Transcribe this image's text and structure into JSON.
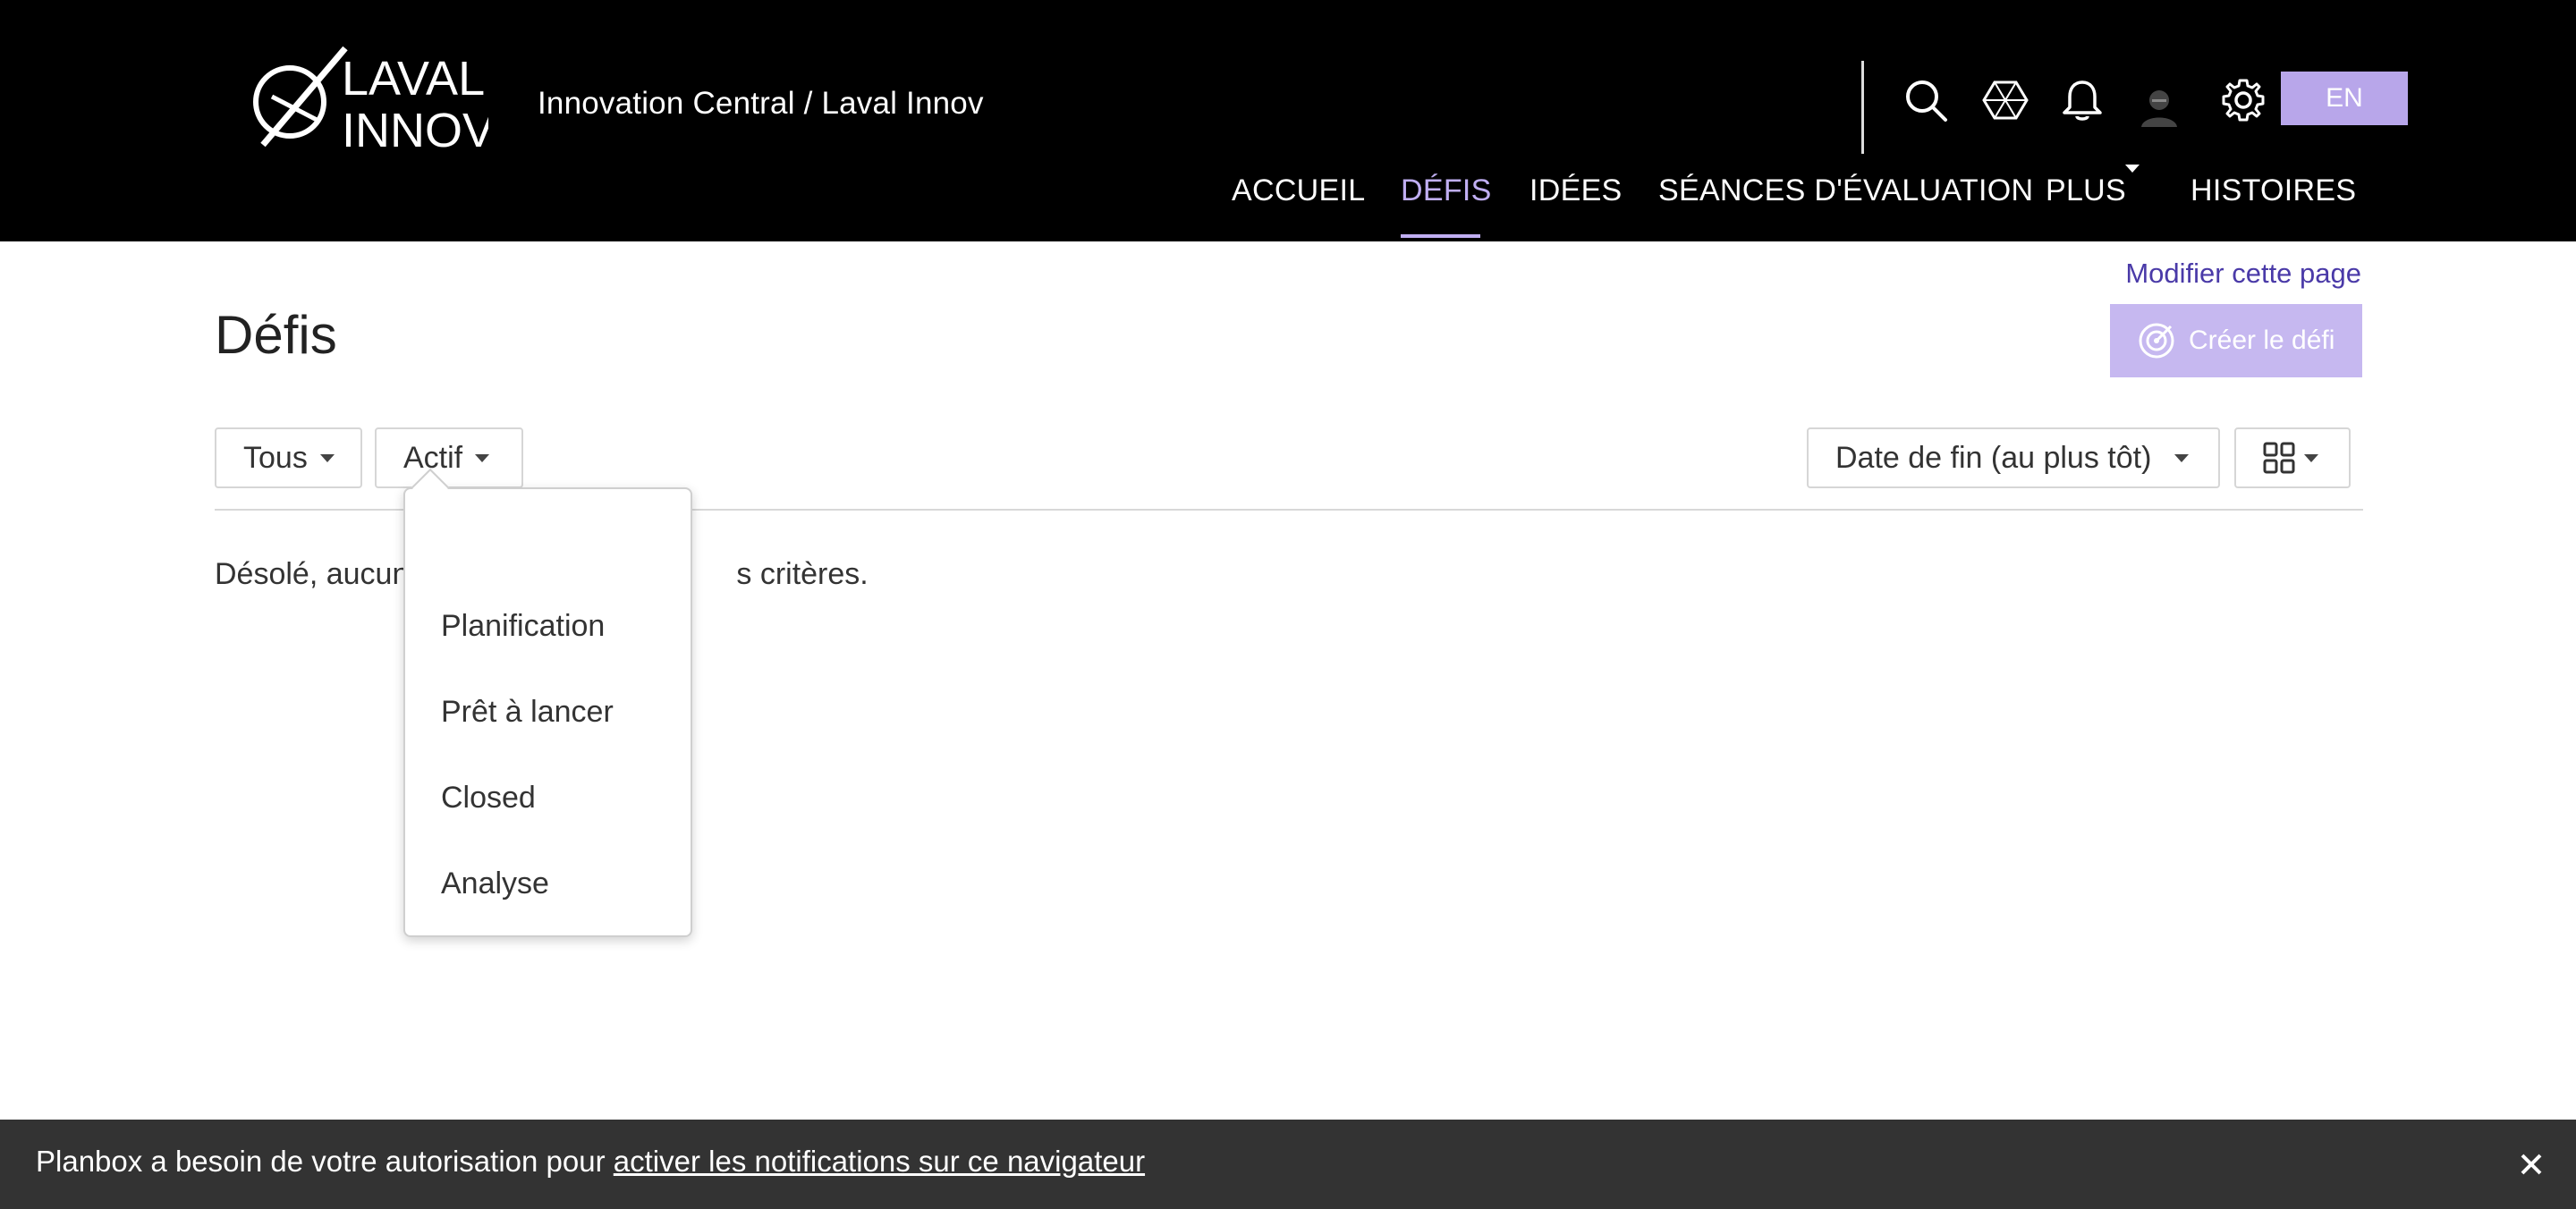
{
  "header": {
    "logo_text": [
      "LAVAL",
      "INNOV"
    ],
    "breadcrumb": "Innovation Central / Laval Innov",
    "language_button": "EN",
    "icons": [
      "search-icon",
      "hexagon-cube-icon",
      "bell-icon",
      "avatar",
      "gear-icon"
    ]
  },
  "nav": {
    "items": [
      {
        "label": "ACCUEIL",
        "active": false
      },
      {
        "label": "DÉFIS",
        "active": true
      },
      {
        "label": "IDÉES",
        "active": false
      },
      {
        "label": "SÉANCES D'ÉVALUATION",
        "active": false
      },
      {
        "label": "PLUS",
        "active": false
      },
      {
        "label": "HISTOIRES",
        "active": false
      }
    ]
  },
  "main": {
    "edit_link": "Modifier cette page",
    "title": "Défis",
    "create_button": "Créer le défi",
    "filters": {
      "scope": "Tous",
      "status": "Actif",
      "sort": "Date de fin (au plus tôt)"
    },
    "empty_message_left": "Désolé, aucun",
    "empty_message_right": "s critères."
  },
  "status_dropdown": {
    "options": [
      "Planification",
      "Prêt à lancer",
      "Closed",
      "Analyse"
    ]
  },
  "notification": {
    "text": "Planbox a besoin de votre autorisation pour ",
    "link": "activer les notifications sur ce navigateur"
  },
  "colors": {
    "header_bg": "#000000",
    "accent": "#c0aef2",
    "button_bg": "#c6b8f0",
    "link": "#4a3aa8",
    "notification_bg": "#333333"
  }
}
